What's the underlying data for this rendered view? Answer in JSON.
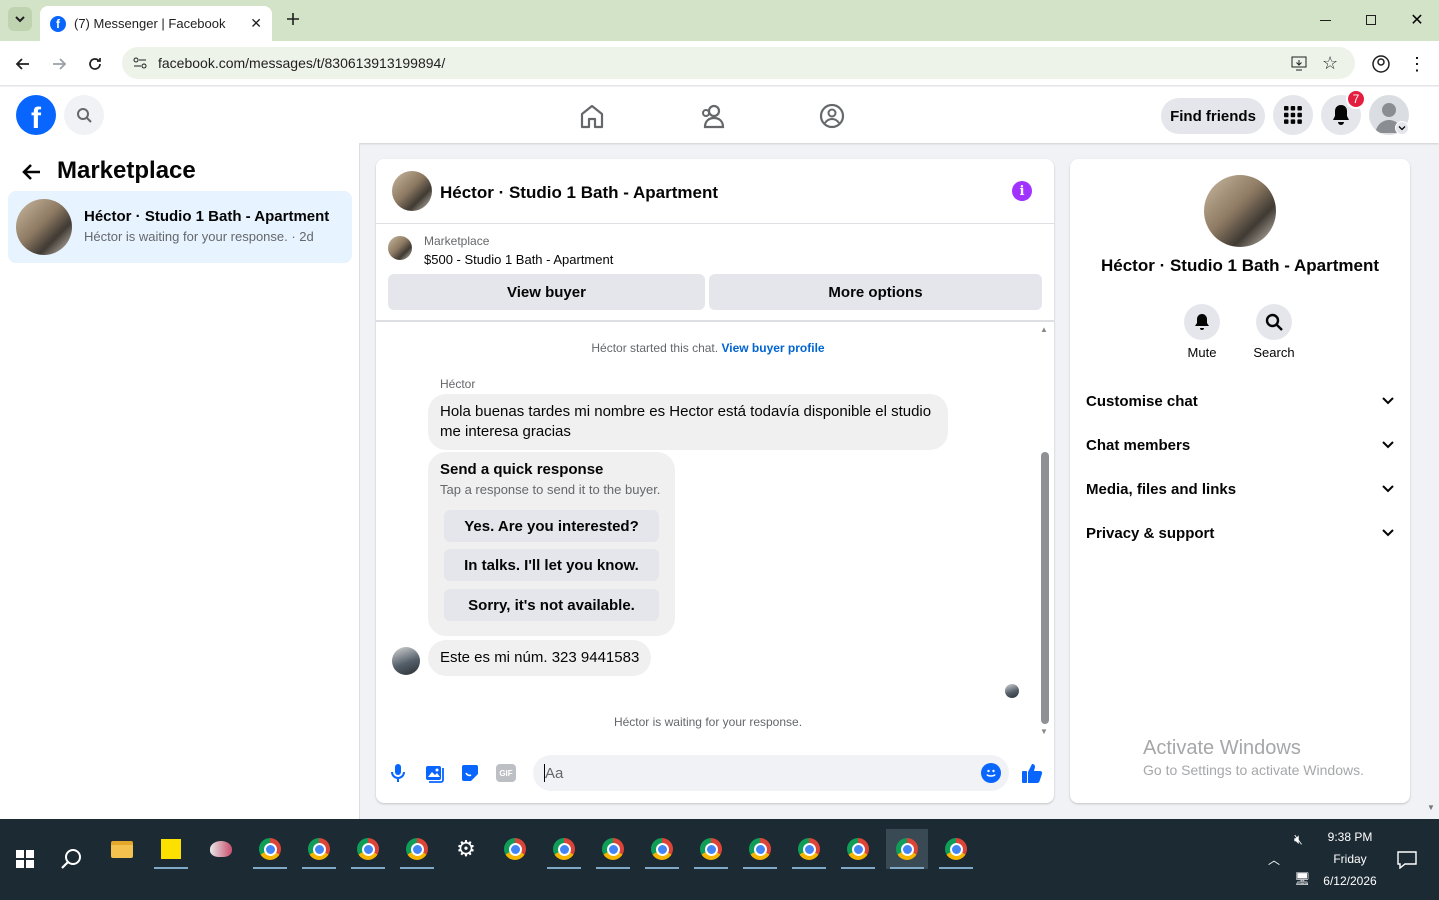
{
  "browser": {
    "tab_title": "(7) Messenger | Facebook",
    "url": "facebook.com/messages/t/830613913199894/"
  },
  "fb_header": {
    "find_friends": "Find friends",
    "notification_count": "7"
  },
  "left": {
    "title": "Marketplace",
    "conversation": {
      "name": "Héctor · Studio 1 Bath - Apartment",
      "preview": "Héctor is waiting for your response. · 2d"
    }
  },
  "chat": {
    "title": "Héctor · Studio 1 Bath - Apartment",
    "listing_source": "Marketplace",
    "listing_title": "$500 - Studio 1 Bath - Apartment",
    "view_buyer": "View buyer",
    "more_options": "More options",
    "started_text": "Héctor started this chat.",
    "view_buyer_profile": "View buyer profile",
    "sender_name": "Héctor",
    "message_1": "Hola buenas tardes mi nombre es Hector está todavía disponible el studio me interesa gracias",
    "quick_title": "Send a quick response",
    "quick_sub": "Tap a response to send it to the buyer.",
    "quick_options": [
      "Yes. Are you interested?",
      "In talks. I'll let you know.",
      "Sorry, it's not available."
    ],
    "message_2": "Este es mi núm. 323 9441583",
    "waiting_text": "Héctor is waiting for your response.",
    "composer_placeholder": "Aa"
  },
  "right": {
    "name": "Héctor · Studio 1 Bath - Apartment",
    "mute": "Mute",
    "search": "Search",
    "sections": [
      "Customise chat",
      "Chat members",
      "Media, files and links",
      "Privacy & support"
    ],
    "watermark_title": "Activate Windows",
    "watermark_sub": "Go to Settings to activate Windows."
  },
  "taskbar": {
    "time": "9:38 PM",
    "day": "Friday",
    "date": "6/12/2026"
  },
  "colors": {
    "fb_blue": "#0866ff",
    "link_blue": "#0064d1",
    "info_purple": "#a033ff",
    "badge_red": "#e41e3f"
  }
}
